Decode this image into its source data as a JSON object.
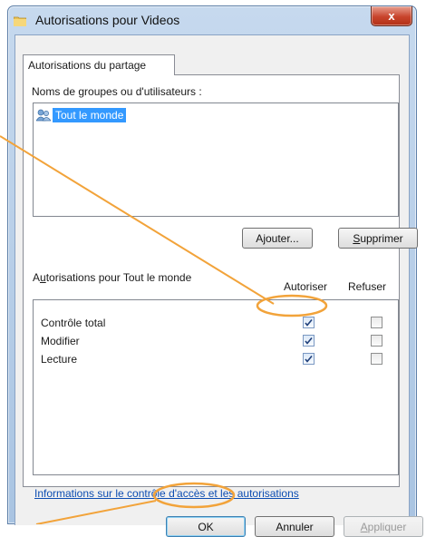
{
  "window": {
    "title": "Autorisations pour Videos",
    "close_label": "x"
  },
  "tab": {
    "label": "Autorisations du partage"
  },
  "groups": {
    "label": "Noms de groupes ou d'utilisateurs :",
    "items": [
      {
        "label": "Tout le monde",
        "selected": true,
        "icon": "users-icon"
      }
    ]
  },
  "buttons": {
    "add": {
      "before": "A",
      "mnemonic": "j",
      "after": "outer..."
    },
    "remove": {
      "before": "",
      "mnemonic": "S",
      "after": "upprimer"
    },
    "ok": "OK",
    "cancel": "Annuler",
    "apply": {
      "before": "",
      "mnemonic": "A",
      "after": "ppliquer"
    }
  },
  "permissions": {
    "label": {
      "before": "A",
      "mnemonic": "u",
      "after": "torisations pour Tout le monde"
    },
    "col_allow": "Autoriser",
    "col_deny": "Refuser",
    "rows": [
      {
        "name": "Contrôle total",
        "allow": true,
        "deny": false
      },
      {
        "name": "Modifier",
        "allow": true,
        "deny": false
      },
      {
        "name": "Lecture",
        "allow": true,
        "deny": false
      }
    ]
  },
  "info_link": "Informations sur le contrôle d'accès et les autorisations",
  "colors": {
    "annotation": "#f2a33a",
    "selection": "#3399ff",
    "link": "#0c4db2"
  }
}
